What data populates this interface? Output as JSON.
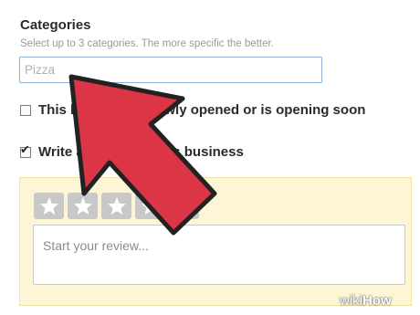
{
  "categories": {
    "heading": "Categories",
    "helper": "Select up to 3 categories. The more specific the better.",
    "placeholder": "Pizza"
  },
  "options": {
    "newly_opened_label": "This business is newly opened or is opening soon",
    "newly_opened_checked": false,
    "write_review_label": "Write a review for this business",
    "write_review_checked": true
  },
  "review": {
    "rating_stars_total": 5,
    "rating_selected": 0,
    "placeholder": "Start your review..."
  },
  "watermark": {
    "wiki": "wiki",
    "how": "How"
  },
  "colors": {
    "arrow": "#dc3545",
    "panel_bg": "#fdf6d6",
    "star_bg": "#c8c8c8",
    "input_border": "#8fb1d6"
  }
}
